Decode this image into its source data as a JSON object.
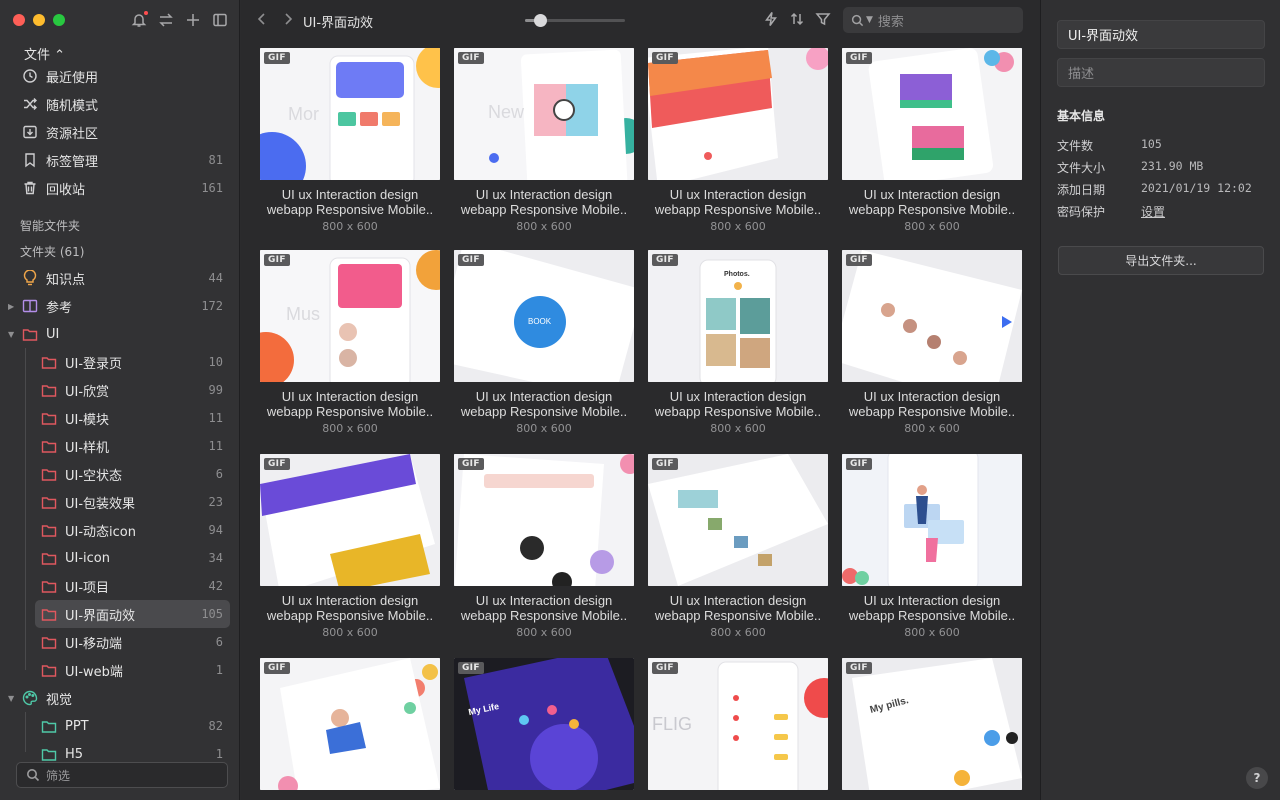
{
  "sidebar": {
    "library_label": "文件 ⌃",
    "items": [
      {
        "label": "最近使用",
        "count": "",
        "icon": "clock-icon"
      },
      {
        "label": "随机模式",
        "count": "",
        "icon": "shuffle-icon"
      },
      {
        "label": "资源社区",
        "count": "",
        "icon": "download-box-icon"
      },
      {
        "label": "标签管理",
        "count": "81",
        "icon": "bookmark-icon"
      },
      {
        "label": "回收站",
        "count": "161",
        "icon": "trash-icon"
      }
    ],
    "smart_folders_title": "智能文件夹",
    "folders_title": "文件夹 (61)",
    "top_folders": [
      {
        "label": "知识点",
        "count": "44",
        "icon": "lightbulb-icon",
        "color": "#f0a64a"
      },
      {
        "label": "参考",
        "count": "172",
        "icon": "book-icon",
        "color": "#b38ee8"
      },
      {
        "label": "UI",
        "count": "",
        "icon": "folder-icon",
        "color": "#e0585f"
      }
    ],
    "ui_children": [
      {
        "label": "UI-登录页",
        "count": "10"
      },
      {
        "label": "UI-欣赏",
        "count": "99"
      },
      {
        "label": "UI-模块",
        "count": "11"
      },
      {
        "label": "UI-样机",
        "count": "11"
      },
      {
        "label": "UI-空状态",
        "count": "6"
      },
      {
        "label": "UI-包装效果",
        "count": "23"
      },
      {
        "label": "UI-动态icon",
        "count": "94"
      },
      {
        "label": "UI-icon",
        "count": "34"
      },
      {
        "label": "UI-项目",
        "count": "42"
      },
      {
        "label": "UI-界面动效",
        "count": "105"
      },
      {
        "label": "UI-移动端",
        "count": "6"
      },
      {
        "label": "UI-web端",
        "count": "1"
      }
    ],
    "visual_folder": {
      "label": "视觉",
      "count": "",
      "icon": "palette-icon",
      "color": "#4fc9a8"
    },
    "visual_children": [
      {
        "label": "PPT",
        "count": "82"
      },
      {
        "label": "H5",
        "count": "1"
      }
    ],
    "filter_placeholder": "筛选"
  },
  "toolbar": {
    "breadcrumb": "UI-界面动效",
    "zoom_level": 0.15,
    "search_placeholder": "搜索"
  },
  "grid": {
    "badge": "GIF",
    "items": [
      {
        "title": "UI ux Interaction design webapp Responsive Mobile",
        "size": "800 x 600"
      },
      {
        "title": "UI ux Interaction design webapp Responsive Mobile",
        "size": "800 x 600"
      },
      {
        "title": "UI ux Interaction design webapp Responsive Mobile",
        "size": "800 x 600"
      },
      {
        "title": "UI ux Interaction design webapp Responsive Mobile",
        "size": "800 x 600"
      },
      {
        "title": "UI ux Interaction design webapp Responsive Mobile",
        "size": "800 x 600"
      },
      {
        "title": "UI ux Interaction design webapp Responsive Mobile",
        "size": "800 x 600"
      },
      {
        "title": "UI ux Interaction design webapp Responsive Mobile",
        "size": "800 x 600"
      },
      {
        "title": "UI ux Interaction design webapp Responsive Mobile",
        "size": "800 x 600"
      },
      {
        "title": "UI ux Interaction design webapp Responsive Mobile",
        "size": "800 x 600"
      },
      {
        "title": "UI ux Interaction design webapp Responsive Mobile",
        "size": "800 x 600"
      },
      {
        "title": "UI ux Interaction design webapp Responsive Mobile",
        "size": "800 x 600"
      },
      {
        "title": "UI ux Interaction design webapp Responsive Mobile",
        "size": "800 x 600"
      },
      {
        "title": "",
        "size": ""
      },
      {
        "title": "",
        "size": ""
      },
      {
        "title": "",
        "size": ""
      },
      {
        "title": "",
        "size": ""
      }
    ]
  },
  "inspector": {
    "title_value": "UI-界面动效",
    "description_placeholder": "描述",
    "info_title": "基本信息",
    "rows": [
      {
        "key": "文件数",
        "value": "105"
      },
      {
        "key": "文件大小",
        "value": "231.90 MB"
      },
      {
        "key": "添加日期",
        "value": "2021/01/19 12:02"
      },
      {
        "key": "密码保护",
        "value": "设置"
      }
    ],
    "export_label": "导出文件夹...",
    "help_label": "?"
  },
  "colors": {
    "sidebar_bg": "#323234",
    "main_bg": "#2a2a2c",
    "selected_row": "#4a4a4d",
    "folder_red": "#e0585f",
    "folder_teal": "#4fc9a8"
  }
}
